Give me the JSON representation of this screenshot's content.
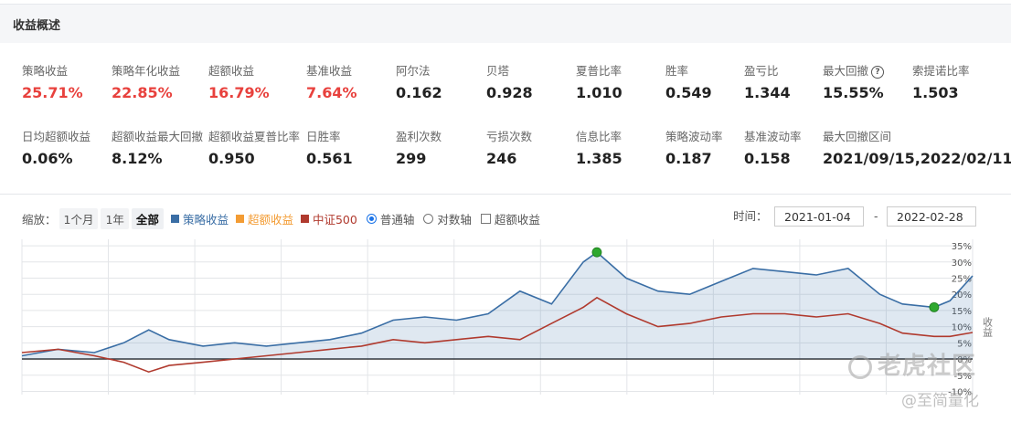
{
  "section_title": "收益概述",
  "metrics_row1": [
    {
      "label": "策略收益",
      "value": "25.71%",
      "red": true
    },
    {
      "label": "策略年化收益",
      "value": "22.85%",
      "red": true
    },
    {
      "label": "超额收益",
      "value": "16.79%",
      "red": true
    },
    {
      "label": "基准收益",
      "value": "7.64%",
      "red": true
    },
    {
      "label": "阿尔法",
      "value": "0.162",
      "red": false
    },
    {
      "label": "贝塔",
      "value": "0.928",
      "red": false
    },
    {
      "label": "夏普比率",
      "value": "1.010",
      "red": false
    },
    {
      "label": "胜率",
      "value": "0.549",
      "red": false
    },
    {
      "label": "盈亏比",
      "value": "1.344",
      "red": false
    },
    {
      "label": "最大回撤",
      "value": "15.55%",
      "red": false,
      "help": "?"
    },
    {
      "label": "索提诺比率",
      "value": "1.503",
      "red": false
    }
  ],
  "metrics_row2": [
    {
      "label": "日均超额收益",
      "value": "0.06%"
    },
    {
      "label": "超额收益最大回撤",
      "value": "8.12%"
    },
    {
      "label": "超额收益夏普比率",
      "value": "0.950"
    },
    {
      "label": "日胜率",
      "value": "0.561"
    },
    {
      "label": "盈利次数",
      "value": "299"
    },
    {
      "label": "亏损次数",
      "value": "246"
    },
    {
      "label": "信息比率",
      "value": "1.385"
    },
    {
      "label": "策略波动率",
      "value": "0.187"
    },
    {
      "label": "基准波动率",
      "value": "0.158"
    },
    {
      "label": "最大回撤区间",
      "value": "2021/09/15,2022/02/11"
    }
  ],
  "controls": {
    "zoom_label": "缩放：",
    "zoom_buttons": [
      "1个月",
      "1年",
      "全部"
    ],
    "legend": [
      {
        "name": "策略收益",
        "color": "#3a6ea5"
      },
      {
        "name": "超额收益",
        "color": "#f39c34"
      },
      {
        "name": "中证500",
        "color": "#b03a2e"
      }
    ],
    "axis_normal": "普通轴",
    "axis_log": "对数轴",
    "excess_checkbox": "超额收益",
    "time_label": "时间：",
    "start_date": "2021-01-04",
    "date_sep": "-",
    "end_date": "2022-02-28"
  },
  "watermark": {
    "line1": "老虎社区",
    "line2": "@至简量化"
  },
  "chart_data": {
    "type": "line",
    "title": "",
    "xlabel": "",
    "ylabel": "收益",
    "x_range": [
      "2021-01-04",
      "2022-02-28"
    ],
    "ylim": [
      -11,
      37
    ],
    "y_ticks": [
      "35%",
      "30%",
      "25%",
      "20%",
      "15%",
      "10%",
      "5%",
      "0%",
      "-5%",
      "-10%"
    ],
    "y_tick_values": [
      35,
      30,
      25,
      20,
      15,
      10,
      5,
      0,
      -5,
      -10
    ],
    "x_grid_count": 11,
    "grid": true,
    "series": [
      {
        "name": "策略收益",
        "color": "#3a6ea5",
        "area": true,
        "x": [
          "2021-01-04",
          "2021-01-20",
          "2021-02-05",
          "2021-02-18",
          "2021-03-01",
          "2021-03-10",
          "2021-03-25",
          "2021-04-08",
          "2021-04-22",
          "2021-05-06",
          "2021-05-20",
          "2021-06-03",
          "2021-06-17",
          "2021-07-01",
          "2021-07-15",
          "2021-07-29",
          "2021-08-12",
          "2021-08-26",
          "2021-09-09",
          "2021-09-15",
          "2021-09-28",
          "2021-10-12",
          "2021-10-26",
          "2021-11-09",
          "2021-11-23",
          "2021-12-07",
          "2021-12-21",
          "2022-01-04",
          "2022-01-18",
          "2022-01-28",
          "2022-02-11",
          "2022-02-18",
          "2022-02-28"
        ],
        "values": [
          1,
          3,
          2,
          5,
          9,
          6,
          4,
          5,
          4,
          5,
          6,
          8,
          12,
          13,
          12,
          14,
          21,
          17,
          30,
          33,
          25,
          21,
          20,
          24,
          28,
          27,
          26,
          28,
          20,
          17,
          16,
          18,
          25.7
        ]
      },
      {
        "name": "中证500",
        "color": "#b03a2e",
        "area": false,
        "x": [
          "2021-01-04",
          "2021-01-20",
          "2021-02-05",
          "2021-02-18",
          "2021-03-01",
          "2021-03-10",
          "2021-03-25",
          "2021-04-08",
          "2021-04-22",
          "2021-05-06",
          "2021-05-20",
          "2021-06-03",
          "2021-06-17",
          "2021-07-01",
          "2021-07-15",
          "2021-07-29",
          "2021-08-12",
          "2021-08-26",
          "2021-09-09",
          "2021-09-15",
          "2021-09-28",
          "2021-10-12",
          "2021-10-26",
          "2021-11-09",
          "2021-11-23",
          "2021-12-07",
          "2021-12-21",
          "2022-01-04",
          "2022-01-18",
          "2022-01-28",
          "2022-02-11",
          "2022-02-18",
          "2022-02-28"
        ],
        "values": [
          2,
          3,
          1,
          -1,
          -4,
          -2,
          -1,
          0,
          1,
          2,
          3,
          4,
          6,
          5,
          6,
          7,
          6,
          11,
          16,
          19,
          14,
          10,
          11,
          13,
          14,
          14,
          13,
          14,
          11,
          8,
          7,
          7,
          8.2
        ]
      }
    ],
    "markers": [
      {
        "name": "drawdown-start",
        "x": "2021-09-15",
        "y": 33,
        "color": "#2ea82e"
      },
      {
        "name": "drawdown-end",
        "x": "2022-02-11",
        "y": 16,
        "color": "#2ea82e"
      }
    ]
  }
}
